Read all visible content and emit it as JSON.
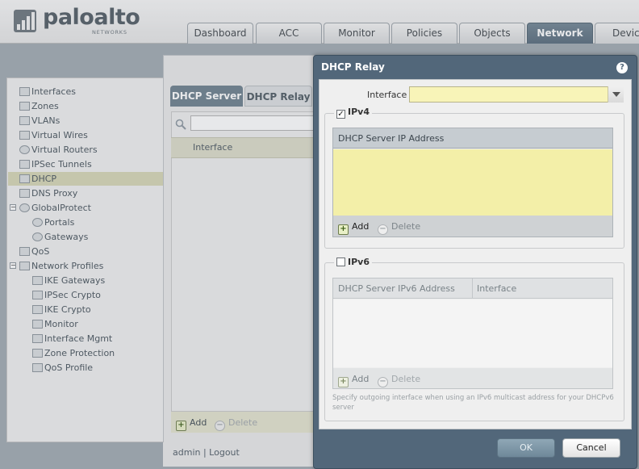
{
  "brand": {
    "name": "paloalto",
    "sub": "NETWORKS"
  },
  "tabs": [
    "Dashboard",
    "ACC",
    "Monitor",
    "Policies",
    "Objects",
    "Network",
    "Device"
  ],
  "active_tab": "Network",
  "tree": {
    "items": [
      "Interfaces",
      "Zones",
      "VLANs",
      "Virtual Wires",
      "Virtual Routers",
      "IPSec Tunnels",
      "DHCP",
      "DNS Proxy",
      "GlobalProtect",
      "Portals",
      "Gateways",
      "QoS",
      "Network Profiles",
      "IKE Gateways",
      "IPSec Crypto",
      "IKE Crypto",
      "Monitor",
      "Interface Mgmt",
      "Zone Protection",
      "QoS Profile"
    ],
    "selected": "DHCP"
  },
  "subtabs": {
    "server": "DHCP Server",
    "relay": "DHCP Relay"
  },
  "grid": {
    "column": "Interface",
    "add": "Add",
    "delete": "Delete"
  },
  "status": {
    "user": "admin",
    "logout": "| Logout"
  },
  "dialog": {
    "title": "DHCP Relay",
    "help": "?",
    "interface_label": "Interface",
    "interface_value": "",
    "ipv4": {
      "legend": "IPv4",
      "checked": true,
      "column": "DHCP Server IP Address",
      "add": "Add",
      "delete": "Delete"
    },
    "ipv6": {
      "legend": "IPv6",
      "checked": false,
      "col1": "DHCP Server IPv6 Address",
      "col2": "Interface",
      "add": "Add",
      "delete": "Delete",
      "note": "Specify outgoing interface when using an IPv6 multicast address for your DHCPv6 server"
    },
    "ok": "OK",
    "cancel": "Cancel"
  },
  "colors": {
    "accent": "#52677a",
    "yellow_field": "#f3efa8",
    "active_tab": "#5f7484"
  }
}
